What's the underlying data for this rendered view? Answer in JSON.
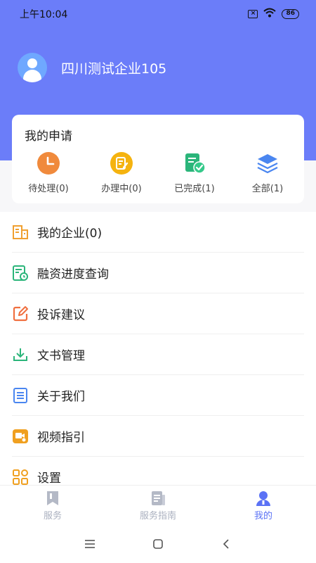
{
  "status_bar": {
    "time": "上午10:04",
    "battery": "86"
  },
  "profile": {
    "company_name": "四川测试企业105"
  },
  "applications": {
    "title": "我的申请",
    "items": [
      {
        "label": "待处理(0)",
        "icon": "clock-icon",
        "color": "#f08a3c"
      },
      {
        "label": "办理中(0)",
        "icon": "document-edit-icon",
        "color": "#f5b30f"
      },
      {
        "label": "已完成(1)",
        "icon": "document-check-icon",
        "color": "#2bb57a"
      },
      {
        "label": "全部(1)",
        "icon": "layers-icon",
        "color": "#4a86f0"
      }
    ]
  },
  "menu": [
    {
      "label": "我的企业(0)",
      "icon": "building-icon",
      "color": "#f0a030"
    },
    {
      "label": "融资进度查询",
      "icon": "progress-query-icon",
      "color": "#2bb57a"
    },
    {
      "label": "投诉建议",
      "icon": "edit-icon",
      "color": "#f07040"
    },
    {
      "label": "文书管理",
      "icon": "download-icon",
      "color": "#2bb57a"
    },
    {
      "label": "关于我们",
      "icon": "list-doc-icon",
      "color": "#4a86f0"
    },
    {
      "label": "视频指引",
      "icon": "video-icon",
      "color": "#f0a020"
    },
    {
      "label": "设置",
      "icon": "grid-icon",
      "color": "#f0a020"
    }
  ],
  "tabs": [
    {
      "label": "服务",
      "icon": "bookmark-icon",
      "active": false
    },
    {
      "label": "服务指南",
      "icon": "guide-doc-icon",
      "active": false
    },
    {
      "label": "我的",
      "icon": "user-icon",
      "active": true
    }
  ],
  "colors": {
    "header": "#6b7df9",
    "active_tab": "#5b72f5",
    "inactive_tab": "#aab0bf"
  }
}
